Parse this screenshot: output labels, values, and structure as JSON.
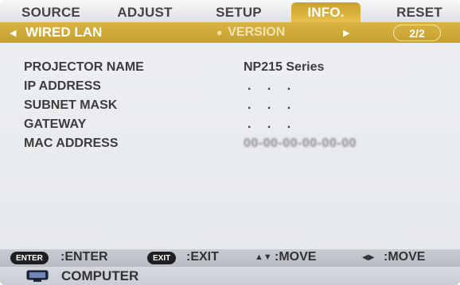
{
  "tabs": [
    {
      "label": "SOURCE",
      "active": false
    },
    {
      "label": "ADJUST",
      "active": false
    },
    {
      "label": "SETUP",
      "active": false
    },
    {
      "label": "INFO.",
      "active": true
    },
    {
      "label": "RESET",
      "active": false
    }
  ],
  "subtabs": {
    "active_label": "WIRED LAN",
    "other_label": "VERSION",
    "page_indicator": "2/2"
  },
  "info_rows": [
    {
      "label": "PROJECTOR NAME",
      "value": "NP215 Series"
    },
    {
      "label": "IP ADDRESS",
      "value": ". . ."
    },
    {
      "label": "SUBNET MASK",
      "value": ". . ."
    },
    {
      "label": "GATEWAY",
      "value": ". . ."
    },
    {
      "label": "MAC ADDRESS",
      "value": "00-00-00-00-00-00"
    }
  ],
  "footer": {
    "enter_key": "ENTER",
    "enter_label": ":ENTER",
    "exit_key": "EXIT",
    "exit_label": ":EXIT",
    "updown_label": ":MOVE",
    "leftright_label": ":MOVE"
  },
  "status": {
    "source_label": "COMPUTER"
  },
  "colors": {
    "accent": "#d4ad3a",
    "background": "#e9ecef",
    "footer": "#c0c4ca"
  }
}
